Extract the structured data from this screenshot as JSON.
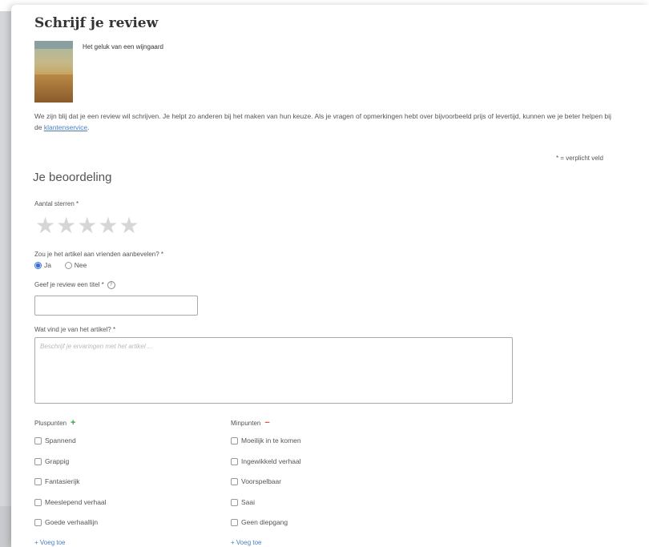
{
  "page": {
    "title": "Schrijf je review",
    "book_title": "Het geluk van een wijngaard",
    "intro_text": "We zijn blij dat je een review wil schrijven. Je helpt zo anderen bij het maken van hun keuze. Als je vragen of opmerkingen hebt over bijvoorbeeld prijs of levertijd, kunnen we je beter helpen bij de ",
    "intro_link": "klantenservice",
    "intro_end": ".",
    "required_note": "* = verplicht veld"
  },
  "form": {
    "section_title": "Je beoordeling",
    "stars_label": "Aantal sterren *",
    "stars_value": 0,
    "stars_max": 5,
    "recommend_label": "Zou je het artikel aan vrienden aanbevelen? *",
    "recommend_options": [
      "Ja",
      "Nee"
    ],
    "recommend_selected": "Ja",
    "title_label": "Geef je review een titel *",
    "title_value": "",
    "body_label": "Wat vind je van het artikel? *",
    "body_placeholder": "Beschrijf je ervaringen met het artikel ..."
  },
  "pluspunten": {
    "label": "Pluspunten",
    "items": [
      "Spannend",
      "Grappig",
      "Fantasierijk",
      "Meeslepend verhaal",
      "Goede verhaallijn"
    ],
    "add_label": "+ Voeg toe"
  },
  "minpunten": {
    "label": "Minpunten",
    "items": [
      "Moeilijk in te komen",
      "Ingewikkeld verhaal",
      "Voorspelbaar",
      "Saai",
      "Geen diepgang"
    ],
    "add_label": "+ Voeg toe"
  },
  "colors": {
    "link": "#4a7fc1",
    "plus": "#3aa33a",
    "minus": "#e05050",
    "star_empty": "#d6d6d6"
  }
}
